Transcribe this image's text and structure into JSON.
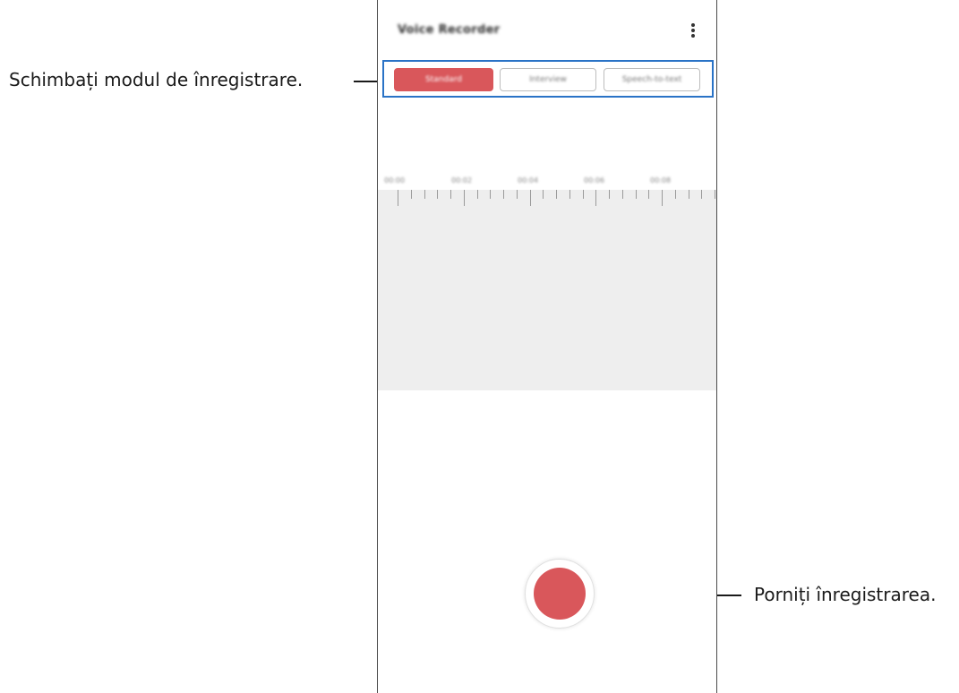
{
  "annotations": {
    "mode_callout": "Schimbați modul de înregistrare.",
    "record_callout": "Porniți înregistrarea."
  },
  "app": {
    "title": "Voice Recorder",
    "more_icon": "more-vert-icon"
  },
  "modes": {
    "items": [
      "Standard",
      "Interview",
      "Speech-to-text"
    ],
    "selected": "Standard"
  },
  "timeline": {
    "labels": [
      "00:00",
      "00:02",
      "00:04",
      "00:06",
      "00:08"
    ]
  },
  "colors": {
    "accent": "#d9575b",
    "highlight_box": "#2a73c6",
    "waveform_bg": "#eeeeee"
  }
}
